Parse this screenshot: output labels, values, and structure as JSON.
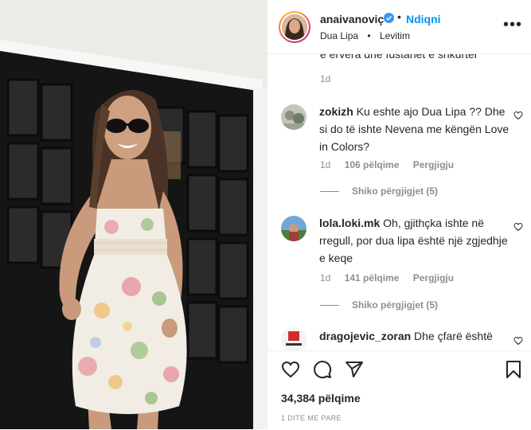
{
  "post": {
    "username": "anaivanoviç",
    "follow_label": "Ndiqni",
    "separator": "•",
    "location": "Dua Lipa",
    "audio": "Levitim",
    "more": "•••"
  },
  "top_comment_clip": {
    "text": "e ervera dhe fustanet e shkurter",
    "age": "1d"
  },
  "comments": [
    {
      "username": "zokizh",
      "text": "Ku eshte ajo Dua Lipa ?? Dhe si do të ishte Nevena me këngën Love in Colors?",
      "age": "1d",
      "likes": "106 pëlqime",
      "reply": "Pergjigju",
      "view_replies": "Shiko përgjigjet (5)"
    },
    {
      "username": "lola.loki.mk",
      "text": "Oh, gjithçka ishte në rregull, por dua lipa është një zgjedhje e keqe",
      "age": "1d",
      "likes": "141 pëlqime",
      "reply": "Pergjigju",
      "view_replies": "Shiko përgjigjet (5)"
    },
    {
      "username": "dragojevic_zoran",
      "text": "Dhe çfarë është"
    }
  ],
  "footer": {
    "likes_total": "34,384 pëlqime",
    "posted": "1 DITE ME PARE"
  },
  "icons": {
    "verified": "verified-badge-icon",
    "heart": "heart-icon",
    "comment": "comment-icon",
    "share": "share-icon",
    "save": "bookmark-icon"
  },
  "colors": {
    "follow": "#0095f6",
    "verified": "#3897f0",
    "muted": "#8e8e8e"
  }
}
